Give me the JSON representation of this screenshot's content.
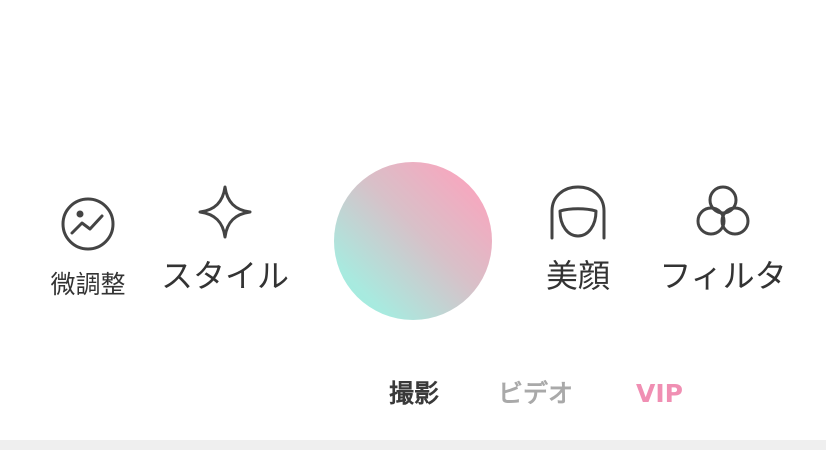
{
  "tools": {
    "adjust": {
      "label": "微調整",
      "icon": "image-adjust-icon"
    },
    "style": {
      "label": "スタイル",
      "icon": "sparkle-icon"
    },
    "beauty": {
      "label": "美顔",
      "icon": "face-icon"
    },
    "filter": {
      "label": "フィルタ",
      "icon": "filter-circles-icon"
    }
  },
  "shutter": {
    "gradient_colors": [
      "#fca3bd",
      "#d8c0c8",
      "#9df0de"
    ]
  },
  "modes": {
    "photo": {
      "label": "撮影",
      "selected": true
    },
    "video": {
      "label": "ビデオ",
      "selected": false
    },
    "vip": {
      "label": "VIP",
      "selected": false,
      "color": "#f08fb3"
    }
  },
  "colors": {
    "icon_stroke": "#444444",
    "text": "#333333",
    "inactive_text": "#a9a9a9"
  }
}
